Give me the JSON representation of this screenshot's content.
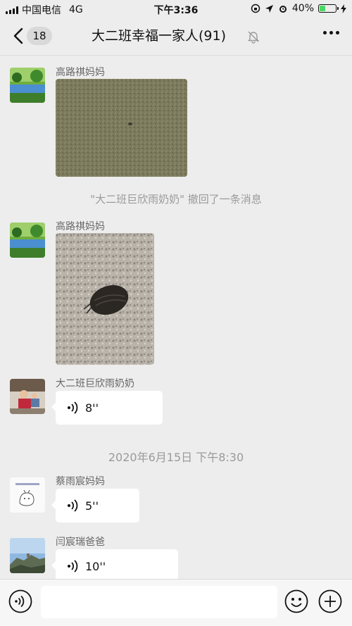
{
  "status_bar": {
    "carrier": "中国电信",
    "network": "4G",
    "time": "下午3:36",
    "battery": "40%",
    "battery_level": 0.4
  },
  "nav": {
    "unread_count": "18",
    "title": "大二班幸福一家人(91)"
  },
  "messages": [
    {
      "sender": "高路祺妈妈",
      "type": "image"
    },
    {
      "type": "system",
      "text": "\"大二班巨欣雨奶奶\" 撤回了一条消息"
    },
    {
      "sender": "高路祺妈妈",
      "type": "image"
    },
    {
      "sender": "大二班巨欣雨奶奶",
      "type": "voice",
      "duration": "8''"
    },
    {
      "type": "timestamp",
      "text": "2020年6月15日 下午8:30"
    },
    {
      "sender": "蔡雨宸妈妈",
      "type": "voice",
      "duration": "5''"
    },
    {
      "sender": "闫宸瑞爸爸",
      "type": "voice",
      "duration": "10''"
    }
  ],
  "colors": {
    "background": "#ededed",
    "bubble": "#ffffff",
    "battery_fill": "#4cd964"
  }
}
